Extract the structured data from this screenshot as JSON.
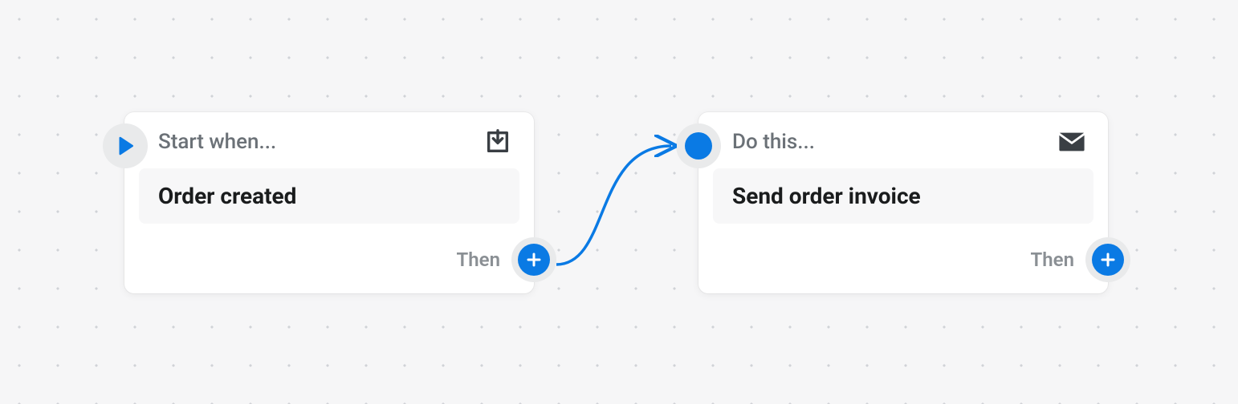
{
  "colors": {
    "accent": "#0a7ae4",
    "muted": "#6b7177",
    "text": "#1a1c1d",
    "halo": "#e9eaeb"
  },
  "icons": {
    "start_badge": "play-arrow",
    "trigger_header": "inbox-download",
    "action_badge": "dot",
    "action_header": "envelope",
    "plus": "plus"
  },
  "trigger": {
    "header_label": "Start when...",
    "body": "Order created",
    "footer_label": "Then"
  },
  "action": {
    "header_label": "Do this...",
    "body": "Send order invoice",
    "footer_label": "Then"
  }
}
